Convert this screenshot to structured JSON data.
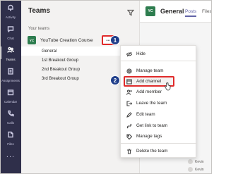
{
  "rail": {
    "items": [
      {
        "label": "Activity",
        "icon": "bell-icon"
      },
      {
        "label": "Chat",
        "icon": "chat-icon"
      },
      {
        "label": "Teams",
        "icon": "teams-icon"
      },
      {
        "label": "Assignments",
        "icon": "assignments-icon"
      },
      {
        "label": "Calendar",
        "icon": "calendar-icon"
      },
      {
        "label": "Calls",
        "icon": "phone-icon"
      },
      {
        "label": "Files",
        "icon": "files-icon"
      }
    ],
    "more": "..."
  },
  "panel": {
    "title": "Teams",
    "section": "Your teams",
    "team": {
      "avatar": "YC",
      "name": "YouTube Creation Course"
    },
    "more_label": "...",
    "channels": [
      "General",
      "1st Breakout Group",
      "2nd Breakout Group",
      "3rd Breakout Group"
    ]
  },
  "badges": {
    "one": "1",
    "two": "2"
  },
  "main": {
    "avatar": "YC",
    "title": "General",
    "tabs": [
      "Posts",
      "Files"
    ],
    "messages": [
      "Kevin",
      "Kevin"
    ]
  },
  "menu": {
    "items": [
      "Hide",
      "Manage team",
      "Add channel",
      "Add member",
      "Leave the team",
      "Edit team",
      "Get link to team",
      "Manage tags",
      "Delete the team"
    ]
  },
  "colors": {
    "rail": "#2f2f4a",
    "accent": "#6264a7",
    "highlight": "#e02a2a",
    "badge": "#1f3e8a",
    "team": "#2e7d4f"
  }
}
